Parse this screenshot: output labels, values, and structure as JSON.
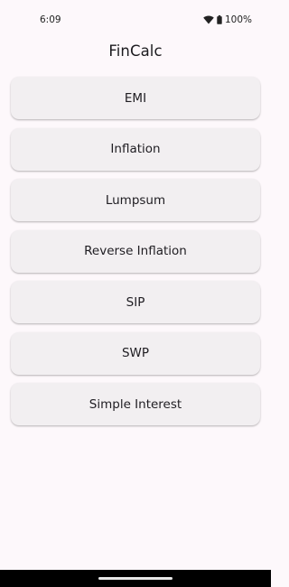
{
  "status_bar": {
    "time": "6:09",
    "battery_percent": "100%",
    "icons": [
      "wifi-icon",
      "battery-icon"
    ]
  },
  "app": {
    "title": "FinCalc"
  },
  "menu": {
    "items": [
      {
        "label": "EMI"
      },
      {
        "label": "Inflation"
      },
      {
        "label": "Lumpsum"
      },
      {
        "label": "Reverse Inflation"
      },
      {
        "label": "SIP"
      },
      {
        "label": "SWP"
      },
      {
        "label": "Simple Interest"
      }
    ]
  },
  "colors": {
    "background": "#fdf8fb",
    "button": "#f2eff1",
    "nav_bar": "#000000"
  }
}
